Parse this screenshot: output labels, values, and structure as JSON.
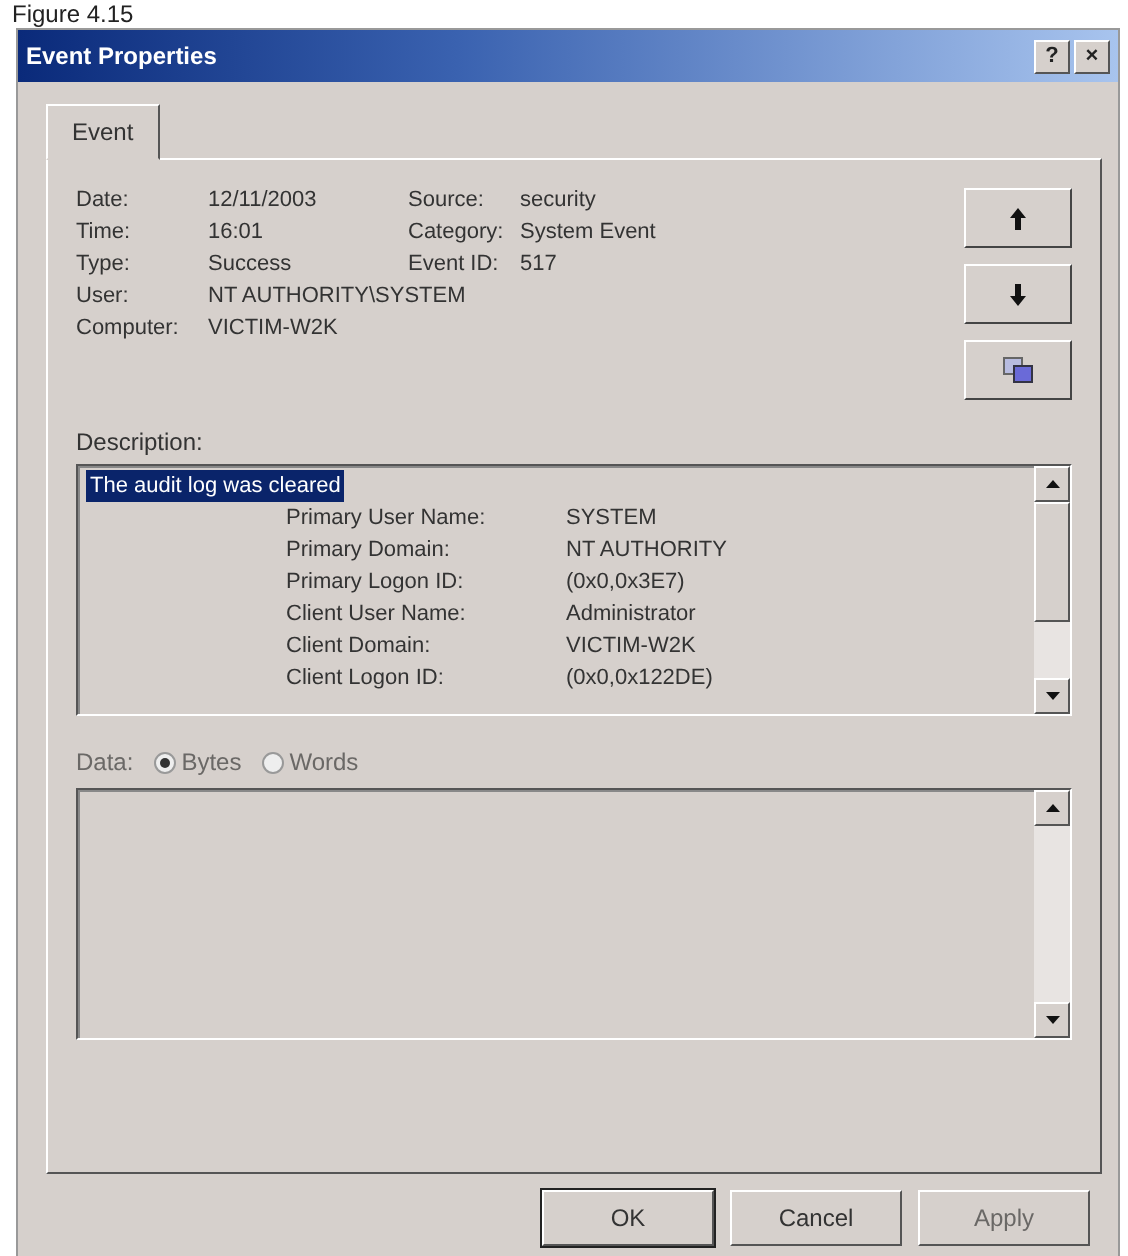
{
  "caption": "Figure 4.15",
  "window": {
    "title": "Event Properties",
    "title_buttons": [
      "?",
      "×"
    ]
  },
  "tabs": [
    {
      "label": "Event",
      "selected": true
    }
  ],
  "fields": [
    {
      "label": "Date:",
      "value": "12/11/2003",
      "label2": "Source:",
      "value2": "security"
    },
    {
      "label": "Time:",
      "value": "16:01",
      "label2": "Category:",
      "value2": "System Event"
    },
    {
      "label": "Type:",
      "value": "Success",
      "label2": "Event ID:",
      "value2": "517"
    },
    {
      "label": "User:",
      "value": "NT AUTHORITY\\SYSTEM"
    },
    {
      "label": "Computer:",
      "value": "VICTIM-W2K"
    }
  ],
  "side_buttons": [
    {
      "kind": "up"
    },
    {
      "kind": "down"
    },
    {
      "kind": "copy"
    }
  ],
  "description": {
    "label": "Description:",
    "first_line": "The audit log was cleared",
    "first_line_selected": true,
    "lines": [
      {
        "name": "Primary User Name:",
        "value": "SYSTEM"
      },
      {
        "name": "Primary Domain:",
        "value": "NT AUTHORITY"
      },
      {
        "name": "Primary Logon ID:",
        "value": "(0x0,0x3E7)"
      },
      {
        "name": "Client User Name:",
        "value": "Administrator"
      },
      {
        "name": "Client Domain:",
        "value": "VICTIM-W2K"
      },
      {
        "name": "Client Logon ID:",
        "value": "(0x0,0x122DE)"
      }
    ]
  },
  "data": {
    "label": "Data:",
    "disabled": true,
    "options": [
      {
        "label": "Bytes",
        "selected": true
      },
      {
        "label": "Words",
        "selected": false
      }
    ]
  },
  "buttons": [
    {
      "label": "OK",
      "disabled": false,
      "default": true
    },
    {
      "label": "Cancel",
      "disabled": false,
      "default": false
    },
    {
      "label": "Apply",
      "disabled": true,
      "default": false
    }
  ]
}
